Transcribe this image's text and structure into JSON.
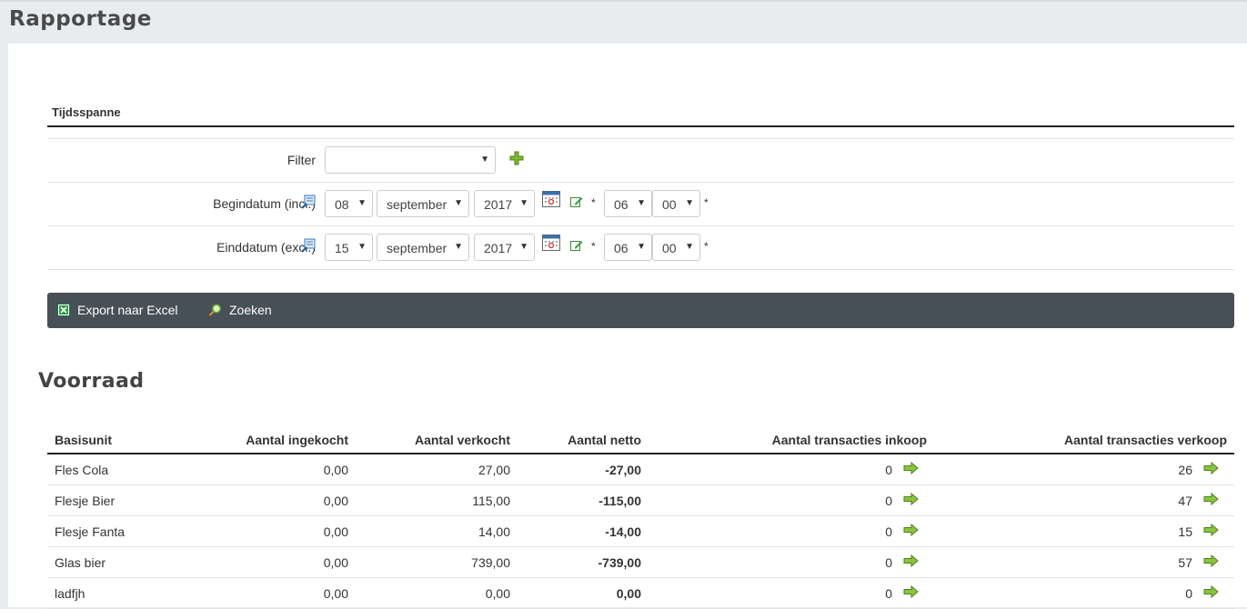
{
  "page": {
    "title": "Rapportage"
  },
  "tijdsspanne": {
    "heading": "Tijdsspanne",
    "filter": {
      "label": "Filter",
      "value": ""
    },
    "begin": {
      "label": "Begindatum (incl.)",
      "day": "08",
      "month": "september",
      "year": "2017",
      "hour": "06",
      "minute": "00",
      "required_mark": "*"
    },
    "end": {
      "label": "Einddatum (excl.)",
      "day": "15",
      "month": "september",
      "year": "2017",
      "hour": "06",
      "minute": "00",
      "required_mark": "*"
    }
  },
  "toolbar": {
    "export_label": "Export naar Excel",
    "search_label": "Zoeken"
  },
  "voorraad": {
    "title": "Voorraad",
    "columns": [
      "Basisunit",
      "Aantal ingekocht",
      "Aantal verkocht",
      "Aantal netto",
      "Aantal transacties inkoop",
      "Aantal transacties verkoop"
    ],
    "rows": [
      {
        "unit": "Fles Cola",
        "ingekocht": "0,00",
        "verkocht": "27,00",
        "netto": "-27,00",
        "tx_inkoop": "0",
        "tx_verkoop": "26"
      },
      {
        "unit": "Flesje Bier",
        "ingekocht": "0,00",
        "verkocht": "115,00",
        "netto": "-115,00",
        "tx_inkoop": "0",
        "tx_verkoop": "47"
      },
      {
        "unit": "Flesje Fanta",
        "ingekocht": "0,00",
        "verkocht": "14,00",
        "netto": "-14,00",
        "tx_inkoop": "0",
        "tx_verkoop": "15"
      },
      {
        "unit": "Glas bier",
        "ingekocht": "0,00",
        "verkocht": "739,00",
        "netto": "-739,00",
        "tx_inkoop": "0",
        "tx_verkoop": "57"
      },
      {
        "unit": "ladfjh",
        "ingekocht": "0,00",
        "verkocht": "0,00",
        "netto": "0,00",
        "tx_inkoop": "0",
        "tx_verkoop": "0"
      }
    ]
  },
  "colors": {
    "toolbar_bg": "#475057",
    "accent_green": "#6aa626"
  }
}
